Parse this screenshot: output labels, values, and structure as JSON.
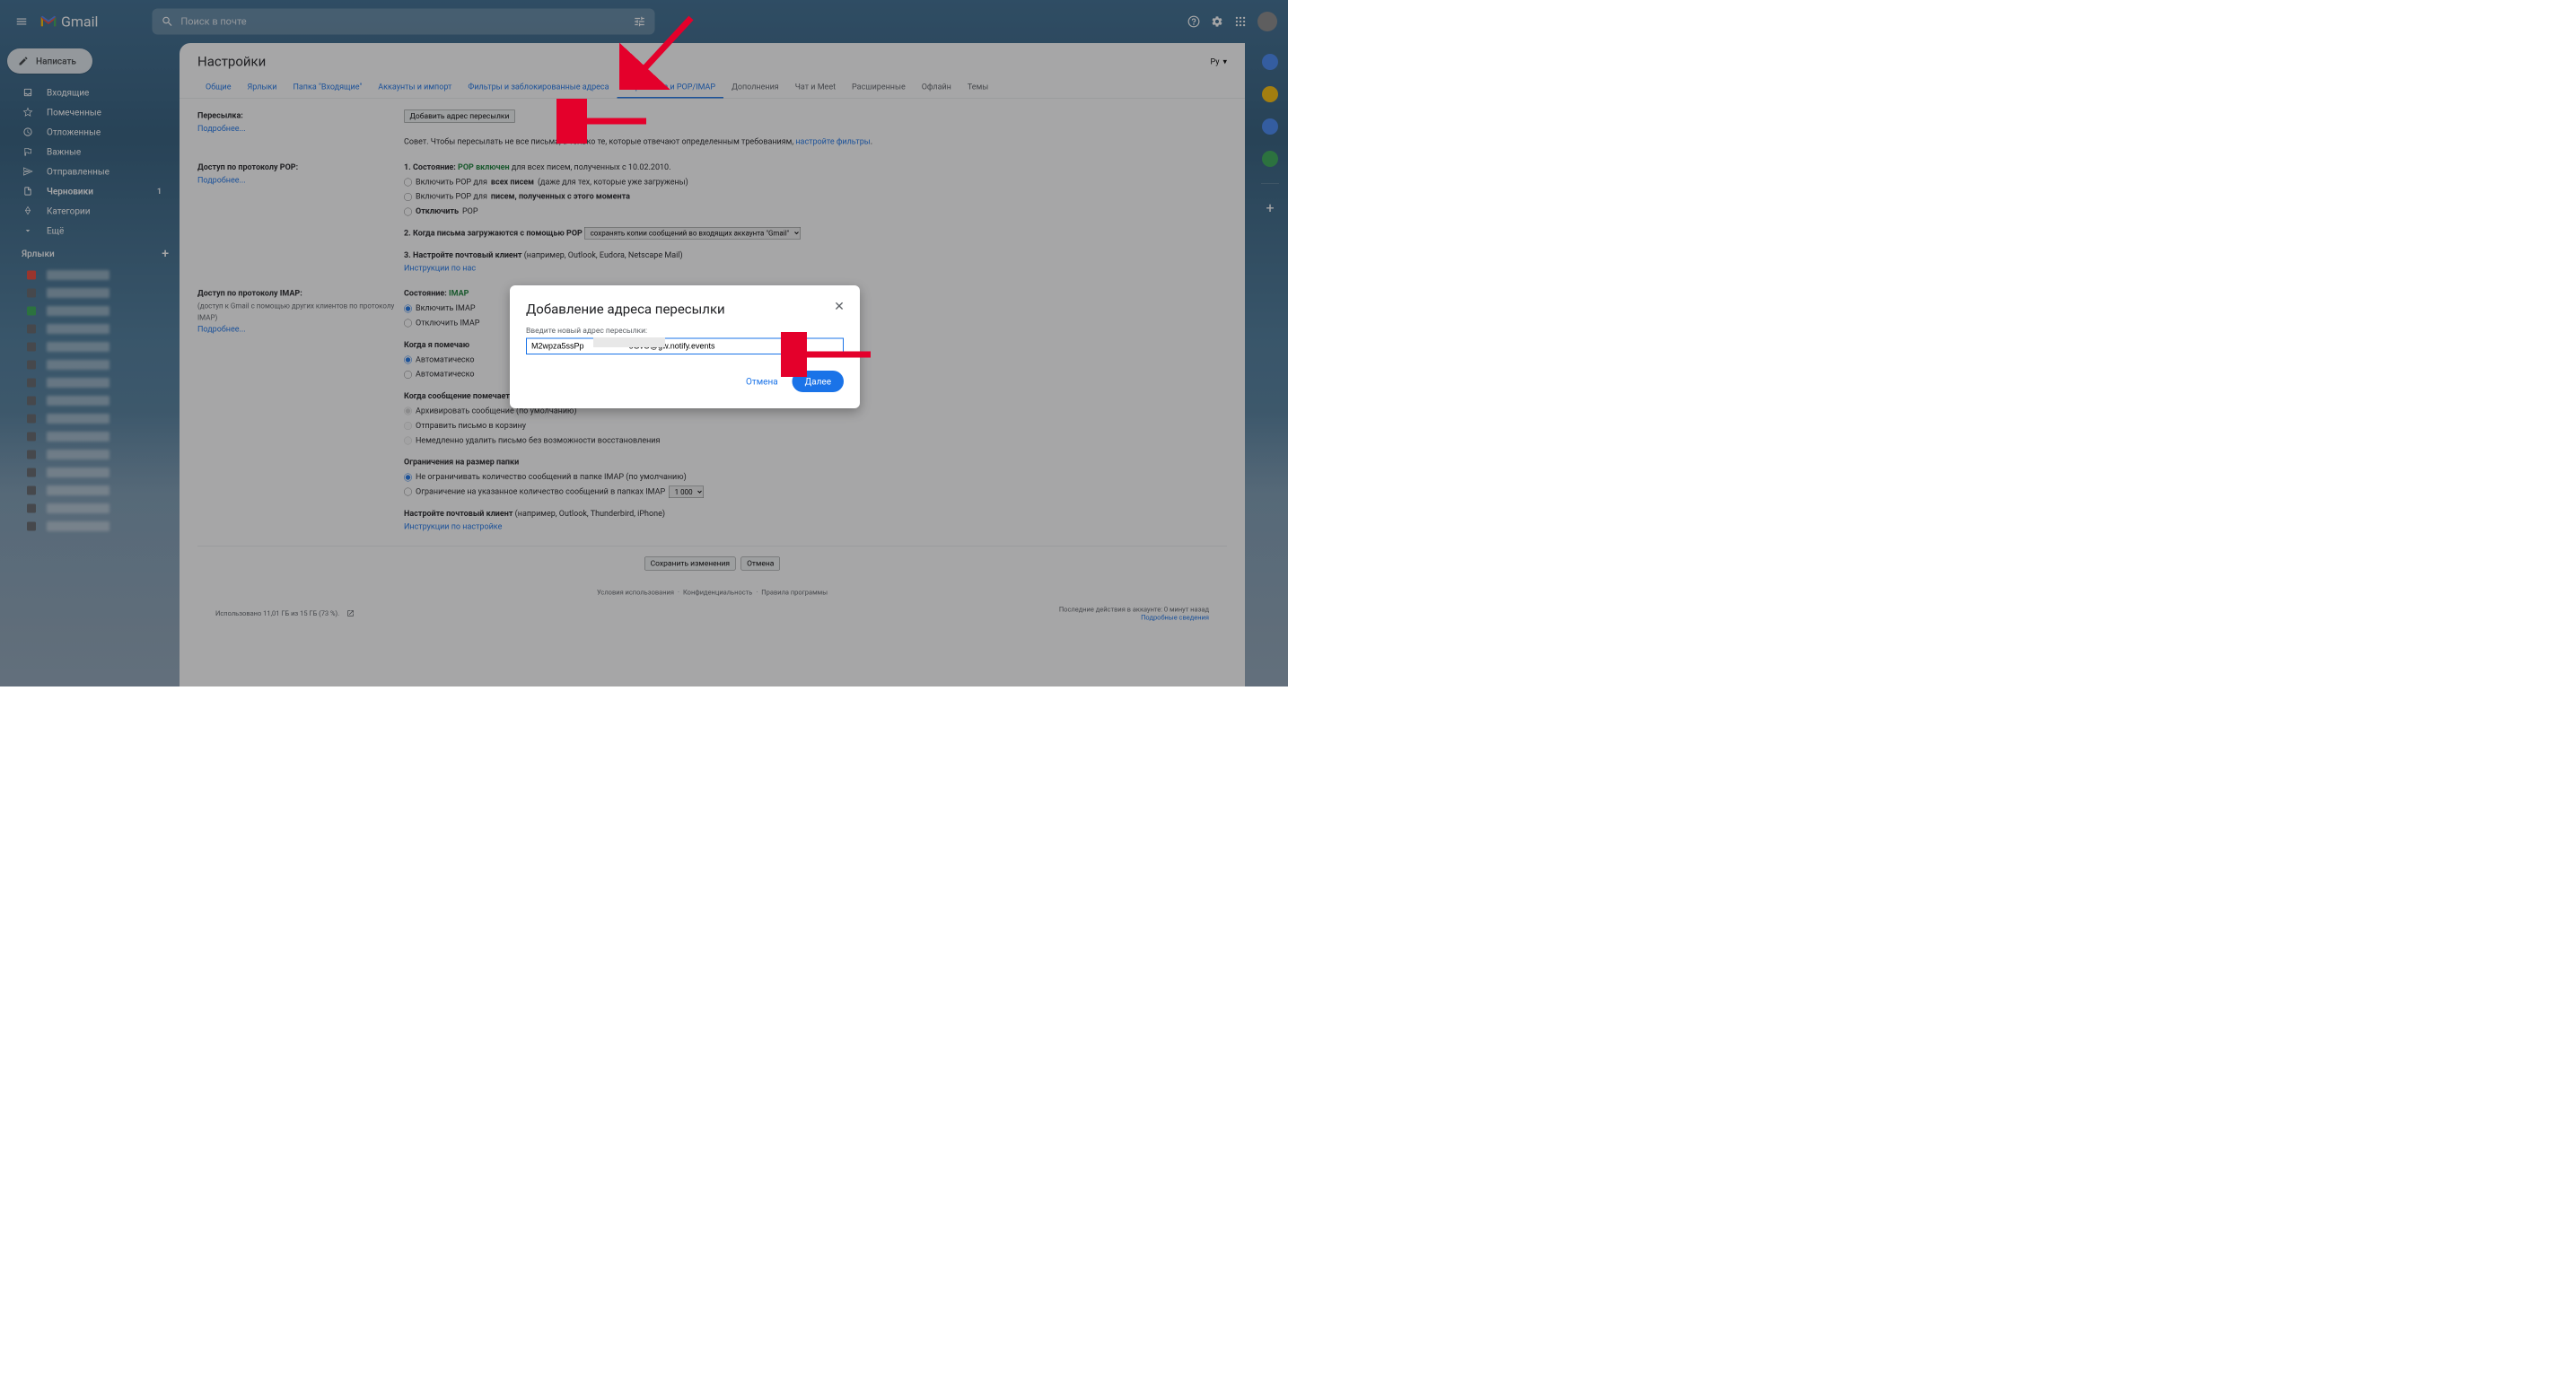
{
  "app": {
    "name": "Gmail",
    "search_placeholder": "Поиск в почте"
  },
  "compose": "Написать",
  "sidebar": {
    "items": [
      {
        "icon": "inbox",
        "label": "Входящие",
        "bold": false
      },
      {
        "icon": "star",
        "label": "Помеченные",
        "bold": false
      },
      {
        "icon": "clock",
        "label": "Отложенные",
        "bold": false
      },
      {
        "icon": "flag",
        "label": "Важные",
        "bold": false
      },
      {
        "icon": "send",
        "label": "Отправленные",
        "bold": false
      },
      {
        "icon": "file",
        "label": "Черновики",
        "count": "1",
        "bold": true
      },
      {
        "icon": "tag",
        "label": "Категории",
        "bold": false
      },
      {
        "icon": "more",
        "label": "Ещё",
        "bold": false
      }
    ],
    "labels_header": "Ярлыки"
  },
  "settings": {
    "title": "Настройки",
    "lang": "Ру",
    "tabs": [
      "Общие",
      "Ярлыки",
      "Папка \"Входящие\"",
      "Аккаунты и импорт",
      "Фильтры и заблокированные адреса",
      "Пересылка и POP/IMAP",
      "Дополнения",
      "Чат и Meet",
      "Расширенные",
      "Офлайн",
      "Темы"
    ],
    "forwarding": {
      "label": "Пересылка:",
      "learn_more": "Подробнее...",
      "add_btn": "Добавить адрес пересылки",
      "tip_prefix": "Совет. Чтобы пересылать не все письма, а только те, которые отвечают определенным требованиям,",
      "tip_link": "настройте фильтры"
    },
    "pop": {
      "label": "Доступ по протоколу POP:",
      "learn_more": "Подробнее...",
      "s1_prefix": "1. Состояние:",
      "s1_status": "POP включен",
      "s1_suffix": " для всех писем, полученных с 10.02.2010.",
      "r1_a": "Включить POP для ",
      "r1_b": "всех писем",
      "r1_c": " (даже для тех, которые уже загружены)",
      "r2_a": "Включить POP для ",
      "r2_b": "писем, полученных с этого момента",
      "r3_a": "Отключить",
      "r3_b": " POP",
      "s2": "2. Когда письма загружаются с помощью POP",
      "s2_select": "сохранять копии сообщений во входящих аккаунта \"Gmail\"",
      "s3_a": "3. Настройте почтовый клиент",
      "s3_b": " (например, Outlook, Eudora, Netscape Mail)",
      "s3_link": "Инструкции по нас"
    },
    "imap": {
      "label": "Доступ по протоколу IMAP:",
      "desc": "(доступ к Gmail с помощью других клиентов по протоколу IMAP)",
      "learn_more": "Подробнее...",
      "s_prefix": "Состояние:",
      "s_status": "IMAP",
      "r1": "Включить IMAP",
      "r2": "Отключить IMAP",
      "h2": "Когда я помечаю",
      "r3": "Автоматическо",
      "r4": "Автоматическо",
      "h3": "Когда сообщение помечается как удаленное и стирается из последней видимой папки IMAP:",
      "r5": "Архивировать сообщение (по умолчанию)",
      "r6": "Отправить письмо в корзину",
      "r7": "Немедленно удалить письмо без возможности восстановления",
      "h4": "Ограничения на размер папки",
      "r8": "Не ограничивать количество сообщений в папке IMAP (по умолчанию)",
      "r9": "Ограничение на указанное количество сообщений в папках IMAP",
      "r9_select": "1 000",
      "cfg_a": "Настройте почтовый клиент",
      "cfg_b": " (например, Outlook, Thunderbird, iPhone)",
      "cfg_link": "Инструкции по настройке"
    },
    "save": "Сохранить изменения",
    "cancel": "Отмена",
    "footer_links": [
      "Условия использования",
      "Конфиденциальность",
      "Правила программы"
    ],
    "storage": "Использовано 11,01 ГБ из 15 ГБ (73 %).",
    "activity": "Последние действия в аккаунте: 0 минут назад",
    "details": "Подробные сведения"
  },
  "dialog": {
    "title": "Добавление адреса пересылки",
    "label": "Введите новый адрес пересылки:",
    "value_prefix": "M2wpza5ssPp",
    "value_suffix": "6GvO@gw.notify.events",
    "cancel": "Отмена",
    "next": "Далее"
  }
}
